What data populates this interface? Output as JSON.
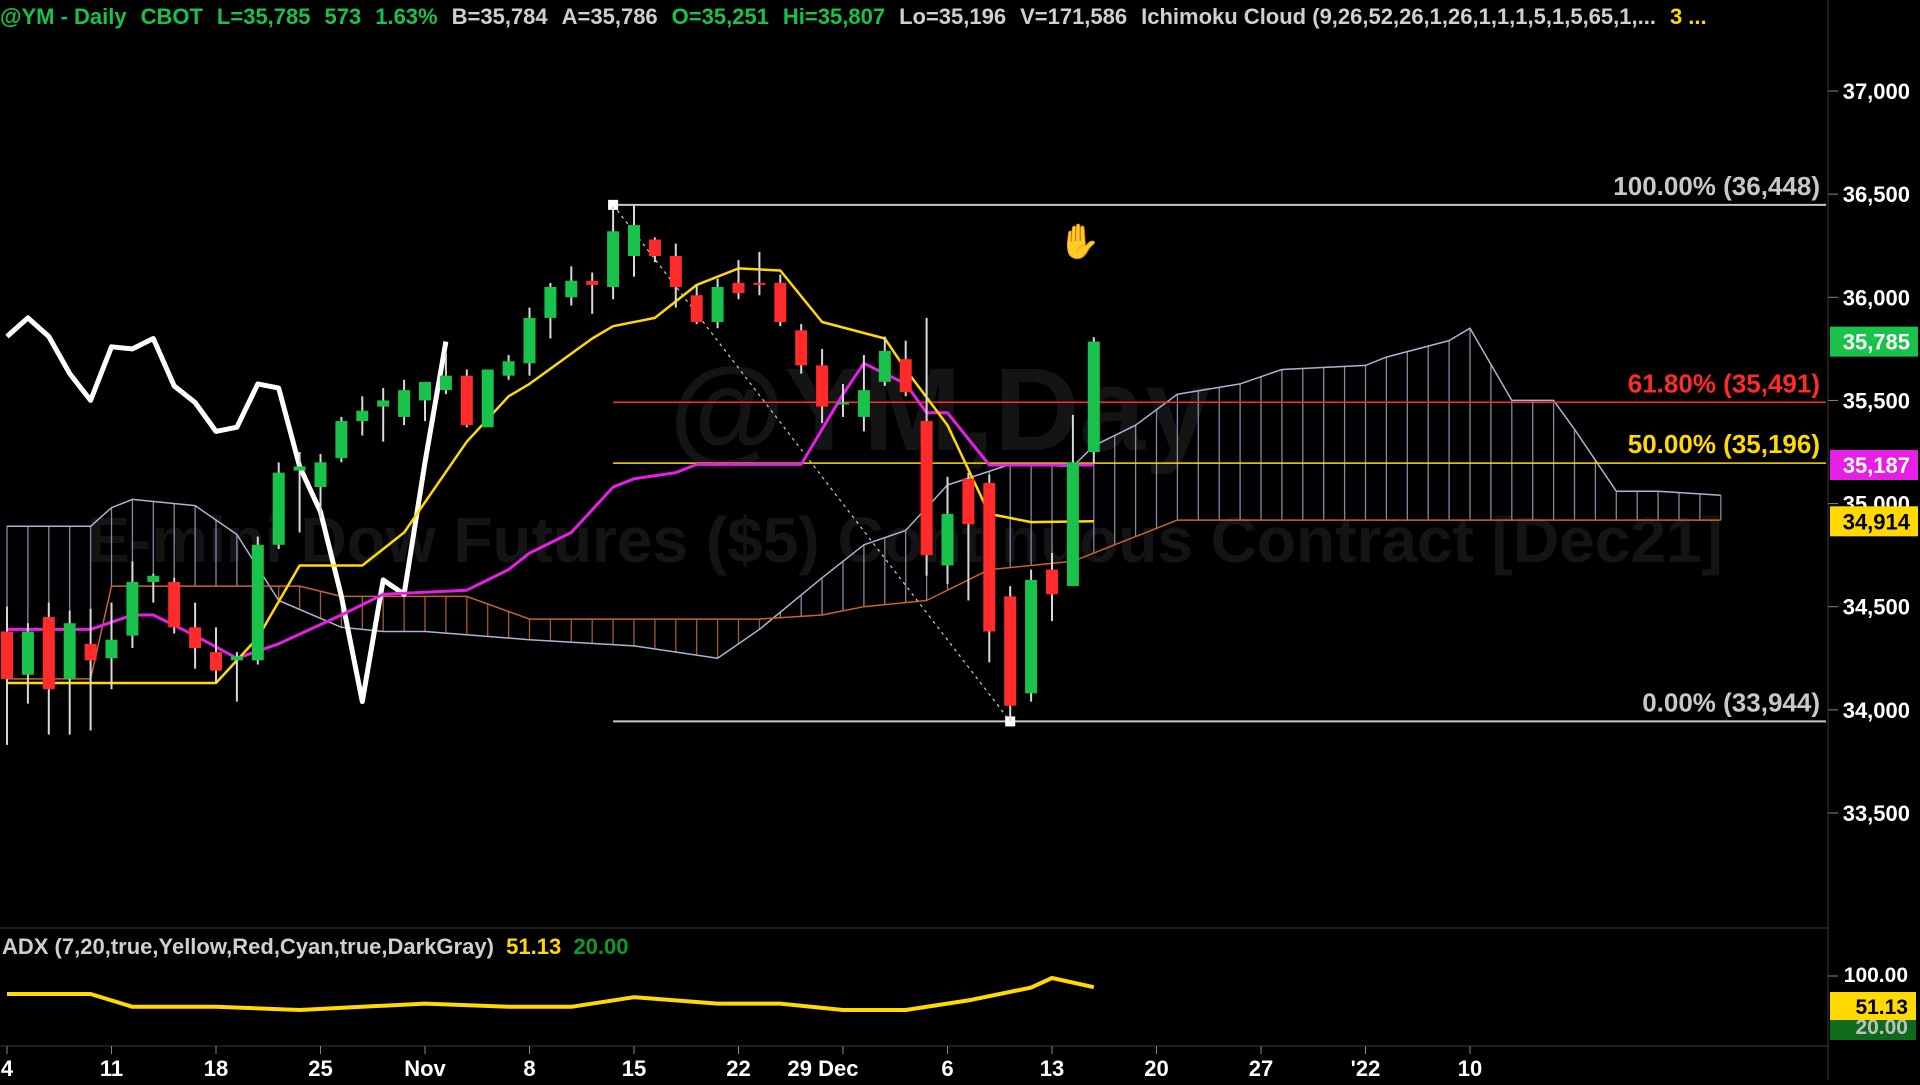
{
  "header": {
    "symbol": "@YM - Daily",
    "exchange": "CBOT",
    "last": "L=35,785",
    "change": "573",
    "change_pct": "1.63%",
    "bid": "B=35,784",
    "ask": "A=35,786",
    "open": "O=35,251",
    "high": "Hi=35,807",
    "low": "Lo=35,196",
    "volume": "V=171,586",
    "indicator": "Ichimoku Cloud (9,26,52,26,1,26,1,1,1,5,1,5,65,1,...",
    "extra": "3 ..."
  },
  "watermark": {
    "line1": "@YM,Day",
    "line2": "E-mini Dow Futures ($5) Continuous Contract [Dec21]"
  },
  "adx_panel": {
    "label": "ADX (7,20,true,Yellow,Red,Cyan,true,DarkGray)",
    "value": "51.13",
    "threshold": "20.00",
    "axis_labels": [
      "100.00"
    ],
    "value_badge": "51.13",
    "threshold_badge": "20.00"
  },
  "fib_levels": [
    {
      "label": "100.00% (36,448)",
      "price": 36448,
      "color": "#c8c8c8"
    },
    {
      "label": "61.80% (35,491)",
      "price": 35491,
      "color": "#ff2a2a"
    },
    {
      "label": "50.00% (35,196)",
      "price": 35196,
      "color": "#ffd900"
    },
    {
      "label": "0.00% (33,944)",
      "price": 33944,
      "color": "#c8c8c8"
    }
  ],
  "price_badges": [
    {
      "label": "35,785",
      "price": 35785,
      "bg": "#19c24a",
      "fg": "#ffffff"
    },
    {
      "label": "35,187",
      "price": 35187,
      "bg": "#e61ee6",
      "fg": "#ffffff"
    },
    {
      "label": "34,914",
      "price": 34914,
      "bg": "#ffd900",
      "fg": "#000000"
    }
  ],
  "icons": {
    "cursor": "hand-cursor-icon"
  },
  "colors": {
    "up": "#19c24a",
    "down": "#ff2a2a",
    "tenkan": "#ffd900",
    "kijun": "#e61ee6",
    "chikou": "#ffffff",
    "span_a": "#aab4d2",
    "span_b": "#c8642d",
    "adx": "#ffd900"
  },
  "chart_data": {
    "type": "candlestick",
    "y_tick_labels": [
      "37,000",
      "36,500",
      "36,000",
      "35,500",
      "35,000",
      "34,500",
      "34,000",
      "33,500"
    ],
    "y_ticks": [
      37000,
      36500,
      36000,
      35500,
      35000,
      34500,
      34000,
      33500
    ],
    "ylim": [
      33000,
      37500
    ],
    "x_tick_labels": [
      "4",
      "11",
      "18",
      "25",
      "Nov",
      "8",
      "15",
      "22",
      "29 Dec",
      "6",
      "13",
      "20",
      "27",
      "'22",
      "10"
    ],
    "x_tick_dates": [
      "2021-10-04",
      "2021-10-11",
      "2021-10-18",
      "2021-10-25",
      "2021-11-01",
      "2021-11-08",
      "2021-11-15",
      "2021-11-22",
      "2021-11-29",
      "2021-12-06",
      "2021-12-13",
      "2021-12-20",
      "2021-12-27",
      "2022-01-03",
      "2022-01-10"
    ],
    "candles": [
      {
        "d": "2021-10-04",
        "o": 34380,
        "h": 34500,
        "l": 33830,
        "c": 34150
      },
      {
        "d": "2021-10-05",
        "o": 34170,
        "h": 34420,
        "l": 34030,
        "c": 34380
      },
      {
        "d": "2021-10-06",
        "o": 34450,
        "h": 34520,
        "l": 33880,
        "c": 34100
      },
      {
        "d": "2021-10-07",
        "o": 34150,
        "h": 34480,
        "l": 33880,
        "c": 34420
      },
      {
        "d": "2021-10-08",
        "o": 34320,
        "h": 34490,
        "l": 33900,
        "c": 34240
      },
      {
        "d": "2021-10-11",
        "o": 34250,
        "h": 34520,
        "l": 34100,
        "c": 34340
      },
      {
        "d": "2021-10-12",
        "o": 34360,
        "h": 34720,
        "l": 34300,
        "c": 34620
      },
      {
        "d": "2021-10-13",
        "o": 34620,
        "h": 34660,
        "l": 34520,
        "c": 34650
      },
      {
        "d": "2021-10-14",
        "o": 34620,
        "h": 34640,
        "l": 34370,
        "c": 34400
      },
      {
        "d": "2021-10-15",
        "o": 34400,
        "h": 34520,
        "l": 34200,
        "c": 34300
      },
      {
        "d": "2021-10-18",
        "o": 34280,
        "h": 34400,
        "l": 34130,
        "c": 34190
      },
      {
        "d": "2021-10-19",
        "o": 34240,
        "h": 34280,
        "l": 34040,
        "c": 34260
      },
      {
        "d": "2021-10-20",
        "o": 34240,
        "h": 34840,
        "l": 34220,
        "c": 34800
      },
      {
        "d": "2021-10-21",
        "o": 34800,
        "h": 35200,
        "l": 34780,
        "c": 35150
      },
      {
        "d": "2021-10-22",
        "o": 35160,
        "h": 35250,
        "l": 34860,
        "c": 35180
      },
      {
        "d": "2021-10-25",
        "o": 35080,
        "h": 35240,
        "l": 34930,
        "c": 35200
      },
      {
        "d": "2021-10-26",
        "o": 35220,
        "h": 35420,
        "l": 35200,
        "c": 35400
      },
      {
        "d": "2021-10-27",
        "o": 35400,
        "h": 35520,
        "l": 35330,
        "c": 35450
      },
      {
        "d": "2021-10-28",
        "o": 35470,
        "h": 35560,
        "l": 35300,
        "c": 35500
      },
      {
        "d": "2021-10-29",
        "o": 35420,
        "h": 35600,
        "l": 35380,
        "c": 35550
      },
      {
        "d": "2021-11-01",
        "o": 35500,
        "h": 35580,
        "l": 35400,
        "c": 35590
      },
      {
        "d": "2021-11-02",
        "o": 35550,
        "h": 35730,
        "l": 35530,
        "c": 35620
      },
      {
        "d": "2021-11-03",
        "o": 35620,
        "h": 35650,
        "l": 35370,
        "c": 35380
      },
      {
        "d": "2021-11-04",
        "o": 35370,
        "h": 35400,
        "l": 35400,
        "c": 35650
      },
      {
        "d": "2021-11-05",
        "o": 35620,
        "h": 35720,
        "l": 35600,
        "c": 35690
      },
      {
        "d": "2021-11-08",
        "o": 35680,
        "h": 35950,
        "l": 35620,
        "c": 35900
      },
      {
        "d": "2021-11-09",
        "o": 35900,
        "h": 36070,
        "l": 35800,
        "c": 36050
      },
      {
        "d": "2021-11-10",
        "o": 36000,
        "h": 36150,
        "l": 35960,
        "c": 36080
      },
      {
        "d": "2021-11-11",
        "o": 36080,
        "h": 36120,
        "l": 35920,
        "c": 36060
      },
      {
        "d": "2021-11-12",
        "o": 36050,
        "h": 36440,
        "l": 35990,
        "c": 36320
      },
      {
        "d": "2021-11-15",
        "o": 36200,
        "h": 36448,
        "l": 36100,
        "c": 36350
      },
      {
        "d": "2021-11-16",
        "o": 36280,
        "h": 36290,
        "l": 36170,
        "c": 36200
      },
      {
        "d": "2021-11-17",
        "o": 36200,
        "h": 36260,
        "l": 35950,
        "c": 36050
      },
      {
        "d": "2021-11-18",
        "o": 36010,
        "h": 36060,
        "l": 35870,
        "c": 35880
      },
      {
        "d": "2021-11-19",
        "o": 35880,
        "h": 36090,
        "l": 35850,
        "c": 36050
      },
      {
        "d": "2021-11-22",
        "o": 36070,
        "h": 36180,
        "l": 35990,
        "c": 36020
      },
      {
        "d": "2021-11-23",
        "o": 36070,
        "h": 36220,
        "l": 36010,
        "c": 36060
      },
      {
        "d": "2021-11-24",
        "o": 36070,
        "h": 36110,
        "l": 35860,
        "c": 35880
      },
      {
        "d": "2021-11-25",
        "o": 35840,
        "h": 35870,
        "l": 35630,
        "c": 35670
      },
      {
        "d": "2021-11-26",
        "o": 35670,
        "h": 35750,
        "l": 35390,
        "c": 35470
      },
      {
        "d": "2021-11-29",
        "o": 35480,
        "h": 35580,
        "l": 35420,
        "c": 35490
      },
      {
        "d": "2021-11-30",
        "o": 35420,
        "h": 35720,
        "l": 35350,
        "c": 35550
      },
      {
        "d": "2021-12-01",
        "o": 35590,
        "h": 35810,
        "l": 35570,
        "c": 35740
      },
      {
        "d": "2021-12-02",
        "o": 35700,
        "h": 35790,
        "l": 35520,
        "c": 35540
      },
      {
        "d": "2021-12-03",
        "o": 35400,
        "h": 35900,
        "l": 34650,
        "c": 34750
      },
      {
        "d": "2021-12-06",
        "o": 34700,
        "h": 35130,
        "l": 34610,
        "c": 34950
      },
      {
        "d": "2021-12-07",
        "o": 35120,
        "h": 35150,
        "l": 34530,
        "c": 34900
      },
      {
        "d": "2021-12-08",
        "o": 35100,
        "h": 35140,
        "l": 34230,
        "c": 34380
      },
      {
        "d": "2021-12-09",
        "o": 34550,
        "h": 34600,
        "l": 33944,
        "c": 34020
      },
      {
        "d": "2021-12-10",
        "o": 34080,
        "h": 34680,
        "l": 34040,
        "c": 34630
      },
      {
        "d": "2021-12-13",
        "o": 34680,
        "h": 34760,
        "l": 34430,
        "c": 34560
      },
      {
        "d": "2021-12-14",
        "o": 34600,
        "h": 35430,
        "l": 34600,
        "c": 35200
      },
      {
        "d": "2021-12-15",
        "o": 35250,
        "h": 35807,
        "l": 35196,
        "c": 35785
      }
    ],
    "tenkan": [
      {
        "d": "2021-10-04",
        "v": 34130
      },
      {
        "d": "2021-10-11",
        "v": 34130
      },
      {
        "d": "2021-10-18",
        "v": 34130
      },
      {
        "d": "2021-10-20",
        "v": 34350
      },
      {
        "d": "2021-10-22",
        "v": 34700
      },
      {
        "d": "2021-10-27",
        "v": 34700
      },
      {
        "d": "2021-10-29",
        "v": 34860
      },
      {
        "d": "2021-11-03",
        "v": 35300
      },
      {
        "d": "2021-11-05",
        "v": 35520
      },
      {
        "d": "2021-11-08",
        "v": 35580
      },
      {
        "d": "2021-11-11",
        "v": 35800
      },
      {
        "d": "2021-11-12",
        "v": 35860
      },
      {
        "d": "2021-11-16",
        "v": 35900
      },
      {
        "d": "2021-11-18",
        "v": 36060
      },
      {
        "d": "2021-11-22",
        "v": 36140
      },
      {
        "d": "2021-11-24",
        "v": 36130
      },
      {
        "d": "2021-11-26",
        "v": 35880
      },
      {
        "d": "2021-12-01",
        "v": 35800
      },
      {
        "d": "2021-12-02",
        "v": 35650
      },
      {
        "d": "2021-12-06",
        "v": 35380
      },
      {
        "d": "2021-12-08",
        "v": 34950
      },
      {
        "d": "2021-12-10",
        "v": 34910
      },
      {
        "d": "2021-12-15",
        "v": 34914
      }
    ],
    "kijun": [
      {
        "d": "2021-10-04",
        "v": 34390
      },
      {
        "d": "2021-10-08",
        "v": 34390
      },
      {
        "d": "2021-10-12",
        "v": 34460
      },
      {
        "d": "2021-10-13",
        "v": 34460
      },
      {
        "d": "2021-10-15",
        "v": 34360
      },
      {
        "d": "2021-10-19",
        "v": 34250
      },
      {
        "d": "2021-10-21",
        "v": 34320
      },
      {
        "d": "2021-10-26",
        "v": 34460
      },
      {
        "d": "2021-10-28",
        "v": 34560
      },
      {
        "d": "2021-11-03",
        "v": 34580
      },
      {
        "d": "2021-11-05",
        "v": 34680
      },
      {
        "d": "2021-11-08",
        "v": 34760
      },
      {
        "d": "2021-11-10",
        "v": 34860
      },
      {
        "d": "2021-11-12",
        "v": 35080
      },
      {
        "d": "2021-11-15",
        "v": 35120
      },
      {
        "d": "2021-11-17",
        "v": 35150
      },
      {
        "d": "2021-11-18",
        "v": 35190
      },
      {
        "d": "2021-11-25",
        "v": 35190
      },
      {
        "d": "2021-11-29",
        "v": 35530
      },
      {
        "d": "2021-11-30",
        "v": 35680
      },
      {
        "d": "2021-12-02",
        "v": 35580
      },
      {
        "d": "2021-12-03",
        "v": 35440
      },
      {
        "d": "2021-12-06",
        "v": 35440
      },
      {
        "d": "2021-12-08",
        "v": 35187
      },
      {
        "d": "2021-12-15",
        "v": 35187
      }
    ],
    "chikou": [
      {
        "d": "2021-10-04",
        "v": 35810
      },
      {
        "d": "2021-10-05",
        "v": 35900
      },
      {
        "d": "2021-10-06",
        "v": 35810
      },
      {
        "d": "2021-10-07",
        "v": 35630
      },
      {
        "d": "2021-10-08",
        "v": 35500
      },
      {
        "d": "2021-10-11",
        "v": 35760
      },
      {
        "d": "2021-10-12",
        "v": 35750
      },
      {
        "d": "2021-10-13",
        "v": 35800
      },
      {
        "d": "2021-10-14",
        "v": 35570
      },
      {
        "d": "2021-10-15",
        "v": 35490
      },
      {
        "d": "2021-10-18",
        "v": 35350
      },
      {
        "d": "2021-10-19",
        "v": 35370
      },
      {
        "d": "2021-10-20",
        "v": 35580
      },
      {
        "d": "2021-10-21",
        "v": 35560
      },
      {
        "d": "2021-10-22",
        "v": 35180
      },
      {
        "d": "2021-10-25",
        "v": 34960
      },
      {
        "d": "2021-10-26",
        "v": 34550
      },
      {
        "d": "2021-10-27",
        "v": 34040
      },
      {
        "d": "2021-10-28",
        "v": 34630
      },
      {
        "d": "2021-10-29",
        "v": 34560
      },
      {
        "d": "2021-11-01",
        "v": 35200
      },
      {
        "d": "2021-11-02",
        "v": 35785
      }
    ],
    "span_a": [
      {
        "d": "2021-10-04",
        "v": 34890
      },
      {
        "d": "2021-10-08",
        "v": 34890
      },
      {
        "d": "2021-10-11",
        "v": 34980
      },
      {
        "d": "2021-10-12",
        "v": 35020
      },
      {
        "d": "2021-10-15",
        "v": 34990
      },
      {
        "d": "2021-10-19",
        "v": 34850
      },
      {
        "d": "2021-10-21",
        "v": 34530
      },
      {
        "d": "2021-10-26",
        "v": 34400
      },
      {
        "d": "2021-10-28",
        "v": 34380
      },
      {
        "d": "2021-11-01",
        "v": 34380
      },
      {
        "d": "2021-11-08",
        "v": 34340
      },
      {
        "d": "2021-11-15",
        "v": 34310
      },
      {
        "d": "2021-11-19",
        "v": 34250
      },
      {
        "d": "2021-11-23",
        "v": 34390
      },
      {
        "d": "2021-11-26",
        "v": 34640
      },
      {
        "d": "2021-11-30",
        "v": 34800
      },
      {
        "d": "2021-12-02",
        "v": 34870
      },
      {
        "d": "2021-12-06",
        "v": 35090
      },
      {
        "d": "2021-12-09",
        "v": 35190
      },
      {
        "d": "2021-12-14",
        "v": 35180
      },
      {
        "d": "2021-12-15",
        "v": 35280
      },
      {
        "d": "2021-12-17",
        "v": 35380
      },
      {
        "d": "2021-12-21",
        "v": 35530
      },
      {
        "d": "2021-12-24",
        "v": 35580
      },
      {
        "d": "2021-12-28",
        "v": 35650
      },
      {
        "d": "2022-01-03",
        "v": 35670
      },
      {
        "d": "2022-01-04",
        "v": 35710
      },
      {
        "d": "2022-01-07",
        "v": 35790
      },
      {
        "d": "2022-01-10",
        "v": 35850
      },
      {
        "d": "2022-01-12",
        "v": 35500
      },
      {
        "d": "2022-01-14",
        "v": 35500
      },
      {
        "d": "2022-01-17",
        "v": 35360
      },
      {
        "d": "2022-01-19",
        "v": 35060
      },
      {
        "d": "2022-01-21",
        "v": 35060
      },
      {
        "d": "2022-01-26",
        "v": 35040
      }
    ],
    "span_b": [
      {
        "d": "2021-10-04",
        "v": 34150
      },
      {
        "d": "2021-10-08",
        "v": 34150
      },
      {
        "d": "2021-10-11",
        "v": 34600
      },
      {
        "d": "2021-10-22",
        "v": 34600
      },
      {
        "d": "2021-10-26",
        "v": 34550
      },
      {
        "d": "2021-11-03",
        "v": 34550
      },
      {
        "d": "2021-11-08",
        "v": 34440
      },
      {
        "d": "2021-11-15",
        "v": 34440
      },
      {
        "d": "2021-11-23",
        "v": 34440
      },
      {
        "d": "2021-11-26",
        "v": 34460
      },
      {
        "d": "2021-11-30",
        "v": 34500
      },
      {
        "d": "2021-12-03",
        "v": 34530
      },
      {
        "d": "2021-12-08",
        "v": 34680
      },
      {
        "d": "2021-12-14",
        "v": 34720
      },
      {
        "d": "2021-12-17",
        "v": 34840
      },
      {
        "d": "2021-12-21",
        "v": 34920
      },
      {
        "d": "2022-01-26",
        "v": 34920
      }
    ],
    "fib_anchor": {
      "high_date": "2021-11-12",
      "high": 36448,
      "low_date": "2021-12-09",
      "low": 33944
    },
    "adx": [
      {
        "d": "2021-10-04",
        "v": 49
      },
      {
        "d": "2021-10-08",
        "v": 49
      },
      {
        "d": "2021-10-12",
        "v": 45
      },
      {
        "d": "2021-10-18",
        "v": 45
      },
      {
        "d": "2021-10-22",
        "v": 44
      },
      {
        "d": "2021-10-27",
        "v": 45
      },
      {
        "d": "2021-11-01",
        "v": 46
      },
      {
        "d": "2021-11-05",
        "v": 45
      },
      {
        "d": "2021-11-10",
        "v": 45
      },
      {
        "d": "2021-11-15",
        "v": 48
      },
      {
        "d": "2021-11-19",
        "v": 46
      },
      {
        "d": "2021-11-24",
        "v": 46
      },
      {
        "d": "2021-11-29",
        "v": 44
      },
      {
        "d": "2021-12-02",
        "v": 44
      },
      {
        "d": "2021-12-07",
        "v": 47
      },
      {
        "d": "2021-12-10",
        "v": 51
      },
      {
        "d": "2021-12-13",
        "v": 54
      },
      {
        "d": "2021-12-15",
        "v": 51.13
      }
    ],
    "adx_ylim": [
      0,
      100
    ]
  }
}
